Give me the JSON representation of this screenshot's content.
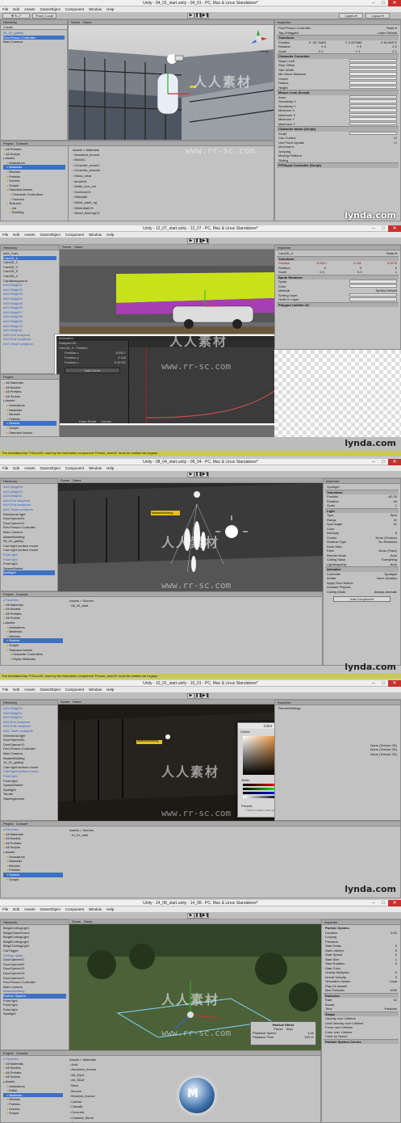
{
  "frames": [
    {
      "title": "Unity - 04_01_start.unity - 04_01 - PC, Mac & Linux Standalone*",
      "menu": [
        "File",
        "Edit",
        "Assets",
        "GameObject",
        "Component",
        "Window",
        "Help"
      ],
      "hierarchy_tab": "Hierarchy",
      "hierarchy_create": "Create",
      "hierarchy": [
        "04_01_gallery",
        "First Person Controller",
        "Main Camera"
      ],
      "scene_tab": "Scene",
      "game_tab": "Game",
      "persp": "< Persp",
      "project_tab": "Project",
      "console_tab": "Console",
      "favorites": [
        "All Prefabs",
        "All Scripts"
      ],
      "assets_label": "Assets",
      "asset_folders": [
        "Animations",
        "Materials",
        "Meshes",
        "Prefabs",
        "Scenes",
        "Scripts",
        "Standard Assets",
        "Character Controllers",
        "Sources",
        "Textures",
        "Art",
        "Building"
      ],
      "assets_path": "Assets > Materials",
      "asset_files": [
        "Anodized_bronze",
        "Brick4C",
        "Concrete_scored",
        "Concrete_smooth",
        "Glass_clear",
        "lambert1",
        "Matte_iron_ore",
        "ScreensCS",
        "Sidewalk",
        "White_paint_sg",
        "WhiteWallCS",
        "Wood_flooringCS"
      ],
      "inspector_tab": "Inspector",
      "object_name": "First Person Controller",
      "tag": "Untagged",
      "layer": "Default",
      "transform_label": "Transform",
      "position": [
        "X -30.76491",
        "Y 3.257863",
        "Z 36.00372"
      ],
      "rotation": [
        "X 0",
        "Y 0",
        "Z 0"
      ],
      "scale": [
        "X 1",
        "Y 1",
        "Z 1"
      ],
      "components": [
        "Character Controller",
        "Mouse Look (Script)",
        "Character Motor (Script)",
        "FPSInput Controller (Script)"
      ],
      "props": [
        "Slope Limit",
        "Step Offset",
        "Skin Width",
        "Min Move Distance",
        "Center",
        "Radius",
        "Height",
        "Axes",
        "Sensitivity X",
        "Sensitivity Y",
        "Minimum X",
        "Maximum X",
        "Minimum Y",
        "Maximum Y",
        "Script",
        "Can Control",
        "Use Fixed Update",
        "Movement",
        "Jumping",
        "Moving Platform",
        "Sliding"
      ],
      "logo": "lynda.com"
    },
    {
      "title": "Unity - 12_07_start.unity - 12_07 - PC, Mac & Linux Standalone*",
      "hierarchy": [
        "ArtX_Cars",
        "Cars2D_0",
        "Cars2D_1",
        "Cars2D_2",
        "Cars2D_3",
        "Cars2D_4",
        "CarsBackground",
        "ArtX-Bldg001",
        "ArtX-Bldg002",
        "ArtX-Bldg003",
        "ArtX-Bldg004",
        "ArtX-Bldg005",
        "ArtX-Bldg006",
        "ArtX-Bldg007",
        "ArtX-Bldg008",
        "ArtX-Bldg009",
        "ArtX-Bldg010",
        "ArtX-Bldg011",
        "ArtX-Eve sculpture",
        "ArtX-Evie sculpture",
        "ArtX-Tower sculpture"
      ],
      "anim_tab": "Animation",
      "anim_clip": "Cars2D_0 : Position",
      "anim_props": [
        "Position.x",
        "Position.y",
        "Position.z"
      ],
      "anim_values": [
        "-5.9517",
        "4.118",
        "5.32762"
      ],
      "add_curve": "Add Curve",
      "dope_sheet": "Dope Sheet",
      "curves": "Curves",
      "samples": "Samples 60",
      "object_name": "Cars2D_0",
      "sprite_renderer": "Sprite Renderer",
      "sprite_props": [
        "Sprite",
        "Color",
        "Material",
        "Sorting Layer",
        "Order in Layer"
      ],
      "sprite_material": "Sprites-Default",
      "polygon_collider": "Polygon Collider 2D",
      "favorites": [
        "All Materials",
        "All Models",
        "All Prefabs",
        "All Scripts"
      ],
      "asset_folders": [
        "Animations",
        "Materials",
        "Meshes",
        "Prefabs",
        "Scenes",
        "Scripts",
        "Standard Assets"
      ],
      "console_msg": "The AnimationClip 'FrDoor2D' used by the Animation component 'French_door02' must be marked as Legacy."
    },
    {
      "title": "Unity - 08_04_start.unity - 08_04 - PC, Mac & Linux Standalone*",
      "hierarchy": [
        "ArtX-Bldg009",
        "ArtX-Bldg010",
        "ArtX-Bldg011",
        "ArtX-Eve sculpture",
        "ArtX-Evie sculpture",
        "ArtX-Tower sculpture",
        "Directional light",
        "DoorOpener01",
        "DoorOpener11",
        "First Person Controller",
        "Main Camera",
        "MasterBuilding",
        "08_04_gallery",
        "Cam light surface mount",
        "Cam light surface mount",
        "Point light",
        "Point light",
        "Point light",
        "SpawnMarker",
        "Spotlight"
      ],
      "building_label": "MasterBuilding",
      "object_name": "Spotlight",
      "light_component": "Light",
      "light_props": [
        "Type",
        "Range",
        "Spot Angle",
        "Color",
        "Intensity",
        "Cookie",
        "Shadow Type",
        "Draw Halo",
        "Flare",
        "Render Mode",
        "Culling Mask",
        "Lightmapping"
      ],
      "light_values": [
        "Spot",
        "10",
        "31",
        "",
        "8",
        "None (Texture)",
        "No Shadows",
        "",
        "None (Flare)",
        "Auto",
        "Everything",
        "Auto"
      ],
      "animator": "Animator",
      "animator_props": [
        "Controller",
        "Avatar",
        "Apply Root Motion",
        "Animate Physics",
        "Culling Mode"
      ],
      "animator_values": [
        "Spotlight",
        "None (Avatar)",
        "",
        "",
        "Always Animate"
      ],
      "add_component": "Add Component",
      "assets_path": "Assets > Scenes",
      "scene_file": "08_04_start",
      "favorites": [
        "All Materials",
        "All Models",
        "All Prefabs",
        "All Scripts"
      ],
      "asset_folders": [
        "Animations",
        "Materials",
        "Meshes",
        "Scenes",
        "Scripts",
        "Standard Assets",
        "Character Controllers",
        "Physic Materials",
        "Scripts",
        "Camera Scripts"
      ]
    },
    {
      "title": "Unity - 10_01_start.unity - 10_01 - PC, Mac & Linux Standalone*",
      "hierarchy": [
        "ArtX-Bldg010",
        "ArtX-Bldg011",
        "ArtX-Bldg012",
        "ArtX-Eve sculpture",
        "ArtX-Evie sculpture",
        "ArtX-Tower sculpture",
        "Directional light",
        "DoorOpener01",
        "DoorOpener11",
        "First Person Controller",
        "Main Camera",
        "MasterBuilding",
        "10_01_gallery",
        "Cam light surface mount",
        "Cam light surface mount",
        "Point light",
        "Point light",
        "SpawnMarker",
        "Spotlight",
        "Terrain",
        "StartingArrows"
      ],
      "render_settings": "RenderSettings",
      "color_window_title": "Color",
      "colors_label": "Colors",
      "slider_label": "Slider",
      "presets_label": "Presets",
      "presets_hint": "Click to add a new preset",
      "slider_values": [
        "20",
        "102",
        "73",
        "255"
      ],
      "building_label": "MasterBuilding",
      "skybox_rows": [
        "None (Texture 2D)",
        "None (Texture 2D)",
        "None (Texture 2D)"
      ],
      "assets_path": "Assets > Scenes",
      "scene_file": "10_01_start",
      "favorites": [
        "All Materials",
        "All Models",
        "All Prefabs",
        "All Scripts"
      ],
      "asset_folders": [
        "Animations",
        "Materials",
        "Meshes",
        "Prefabs",
        "Scenes",
        "Scripts"
      ]
    },
    {
      "title": "Unity - 14_08_start.unity - 14_08 - PC, Mac & Linux Standalone*",
      "hierarchy": [
        "BldgACeilingLight",
        "BldgAGlassSound",
        "BldgBCeilingLight",
        "BldgBCeilingLight",
        "BldgCCeilingLight",
        "CarTrigger",
        "Ceiling Lights",
        "DoorOpener01",
        "DoorOpener02",
        "DoorOpener11",
        "DoorOpener13",
        "DoorOpener21",
        "First Person Controller",
        "Main Camera",
        "MasterBuilding",
        "Particle System",
        "Point light",
        "Point light",
        "Point light",
        "Spotlight"
      ],
      "particle_effect": "Particle Effect",
      "pause": "Pause",
      "stop": "Stop",
      "playback_speed": "Playback Speed",
      "playback_speed_val": "1.00",
      "playback_time": "Playback Time",
      "playback_time_val": "128.11",
      "object_name": "Particle System",
      "ps_props": [
        "Duration",
        "Looping",
        "Prewarm",
        "Start Delay",
        "Start Lifetime",
        "Start Speed",
        "Start Size",
        "Start Rotation",
        "Start Color",
        "Gravity Multiplier",
        "Inherit Velocity",
        "Simulation Space",
        "Play On Awake",
        "Max Particles"
      ],
      "ps_values": [
        "5.00",
        "",
        "",
        "0",
        "5",
        "5",
        "1",
        "0",
        "",
        "0",
        "0",
        "Local",
        "",
        "1000"
      ],
      "emission": "Emission",
      "shape": "Shape",
      "shape_rows": [
        "Rate",
        "Bursts",
        "Time",
        "Particles"
      ],
      "modules": [
        "Velocity over Lifetime",
        "Limit Velocity over Lifetime",
        "Force over Lifetime",
        "Color over Lifetime",
        "Color by Speed"
      ],
      "ps_curves": "Particle System Curves",
      "assets_path": "Assets > Materials",
      "asset_files": [
        "Acid",
        "Anodized_bronze",
        "Art_Eyes",
        "Art_Skull",
        "Brick",
        "Bronze",
        "Brushed_bronze",
        "Carbon",
        "Catwalk",
        "Concrete",
        "Cracked_Stone",
        "Concrete",
        "Marble_Chips"
      ],
      "favorites": [
        "All Materials",
        "All Models",
        "All Prefabs",
        "All Scripts"
      ],
      "asset_folders": [
        "Animations",
        "Editor",
        "Materials",
        "Meshes",
        "Prefabs",
        "Scenes",
        "Scripts"
      ]
    }
  ],
  "watermark_cn": "人人素材",
  "watermark_url": "www.rr-sc.com",
  "logo": "lynda.com",
  "colors": {
    "selection": "#3c71c4",
    "console_warn": "#c9c950",
    "close_btn": "#c9302c"
  }
}
